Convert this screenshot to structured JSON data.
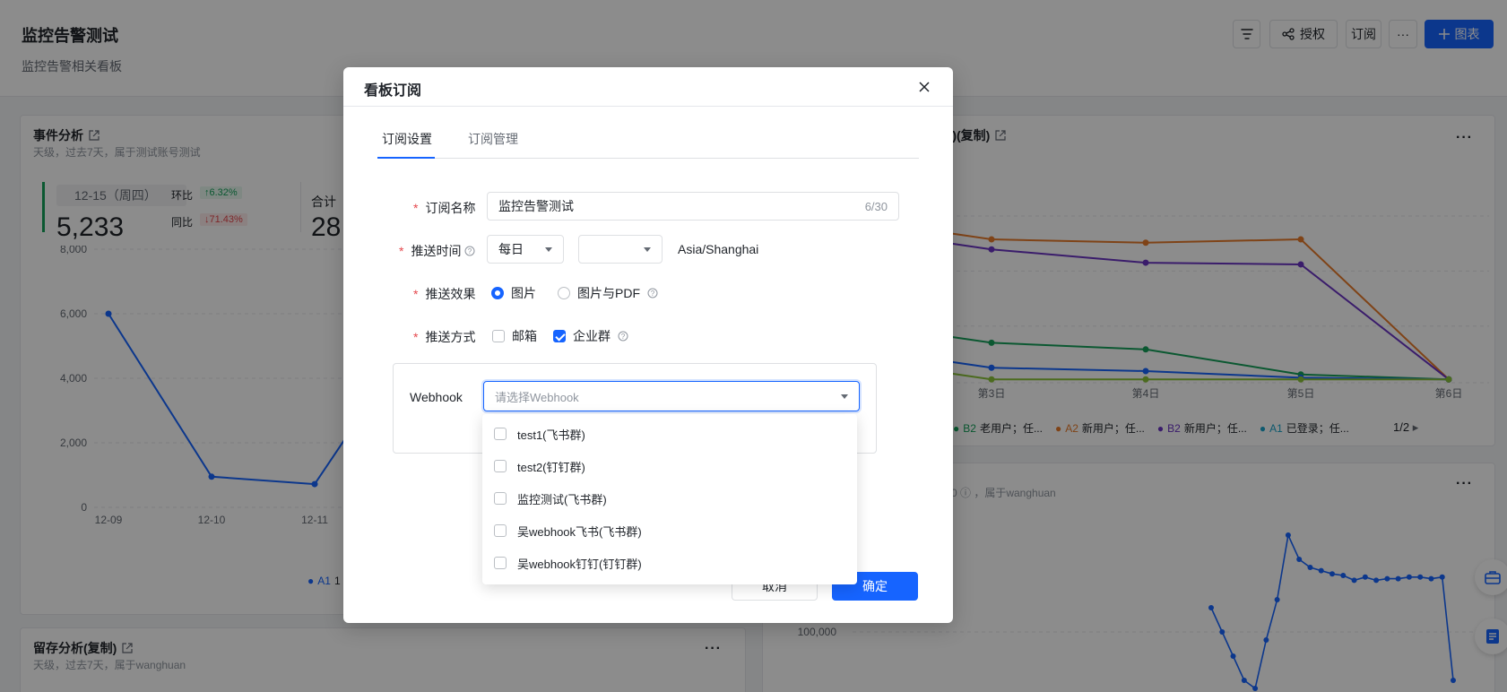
{
  "page": {
    "title": "监控告警测试",
    "subtitle": "监控告警相关看板",
    "toolbar": {
      "filter_icon": "filter-icon",
      "share_label": "授权",
      "subscribe_label": "订阅",
      "more_label": "···",
      "add_chart_label": "图表"
    }
  },
  "cards": {
    "event": {
      "title": "事件分析",
      "subtitle": "天级，过去7天，属于测试账号测试",
      "date_chip": "12-15（周四）",
      "value": "5,233",
      "ring_label": "环比",
      "ring_value": "6.32%",
      "yoy_label": "同比",
      "yoy_value": "71.43%",
      "total_label": "合计",
      "total_value": "28,",
      "legend_label": "A1",
      "legend_tail": "1"
    },
    "right_top": {
      "title": "制)(复制)(复制)",
      "more": "···",
      "legend": [
        {
          "code": "B2",
          "text": "老用户；任...",
          "color": "#14a05a"
        },
        {
          "code": "A2",
          "text": "新用户；任...",
          "color": "#e87b2a"
        },
        {
          "code": "B2",
          "text": "新用户；任...",
          "color": "#6b34c4"
        },
        {
          "code": "A1",
          "text": "已登录；任...",
          "color": "#1aa3c8"
        }
      ],
      "pager": "1/2"
    },
    "right_mid": {
      "more": "···",
      "subtitle_tail": "0 ⓘ ，属于wanghuan"
    },
    "retention": {
      "title": "留存分析(复制)",
      "subtitle": "天级，过去7天，属于wanghuan",
      "more": "···"
    }
  },
  "chart_data": [
    {
      "type": "line",
      "categories": [
        "12-09",
        "12-10",
        "12-11"
      ],
      "series": [
        {
          "name": "A1",
          "values": [
            6000,
            950,
            720
          ]
        }
      ],
      "ylim": [
        0,
        8000
      ],
      "yticks": [
        "8,000",
        "6,000",
        "4,000",
        "2,000",
        "0"
      ],
      "color": "#1664ff"
    },
    {
      "type": "line",
      "categories": [
        "第3日",
        "第4日",
        "第5日",
        "第6日"
      ],
      "series": [
        {
          "name": "A2",
          "values": [
            0.86,
            0.84,
            0.86,
            0.02
          ]
        },
        {
          "name": "B2",
          "values": [
            0.8,
            0.72,
            0.71,
            0.02
          ]
        },
        {
          "name": "B2",
          "values": [
            0.24,
            0.2,
            0.05,
            0.02
          ]
        },
        {
          "name": "A1",
          "values": [
            0.09,
            0.07,
            0.03,
            0.02
          ]
        },
        {
          "name": "",
          "values": [
            0.02,
            0.02,
            0.02,
            0.02
          ]
        }
      ],
      "colors": [
        "#e87b2a",
        "#6b34c4",
        "#14a05a",
        "#1664ff",
        "#8ac43a"
      ]
    },
    {
      "type": "line",
      "ytick": "100,000",
      "series": [
        {
          "name": "",
          "values": [
            0.55,
            0.4,
            0.25,
            0.1,
            0.05,
            0.35,
            0.6,
            1.0,
            0.85,
            0.8,
            0.78,
            0.76,
            0.75,
            0.72,
            0.74,
            0.72,
            0.73,
            0.73,
            0.74,
            0.74,
            0.73,
            0.74,
            0.1
          ]
        }
      ],
      "color": "#1664ff"
    }
  ],
  "modal": {
    "title": "看板订阅",
    "close_icon": "close-icon",
    "tabs": [
      "订阅设置",
      "订阅管理"
    ],
    "form": {
      "name_label": "订阅名称",
      "name_value": "监控告警测试",
      "name_count": "6/30",
      "time_label": "推送时间",
      "time_freq": "每日",
      "time_slot": "",
      "timezone": "Asia/Shanghai",
      "effect_label": "推送效果",
      "effect_options": [
        "图片",
        "图片与PDF"
      ],
      "effect_selected": "图片",
      "method_label": "推送方式",
      "method_options": [
        {
          "label": "邮箱",
          "checked": false
        },
        {
          "label": "企业群",
          "checked": true
        }
      ],
      "webhook_label": "Webhook",
      "webhook_placeholder": "请选择Webhook"
    },
    "webhook_options": [
      "test1(飞书群)",
      "test2(钉钉群)",
      "监控测试(飞书群)",
      "吴webhook飞书(飞书群)",
      "吴webhook钉钉(钉钉群)"
    ],
    "cancel_label": "取消",
    "confirm_label": "确定"
  },
  "colors": {
    "primary": "#1664ff",
    "required": "#e5484d"
  }
}
